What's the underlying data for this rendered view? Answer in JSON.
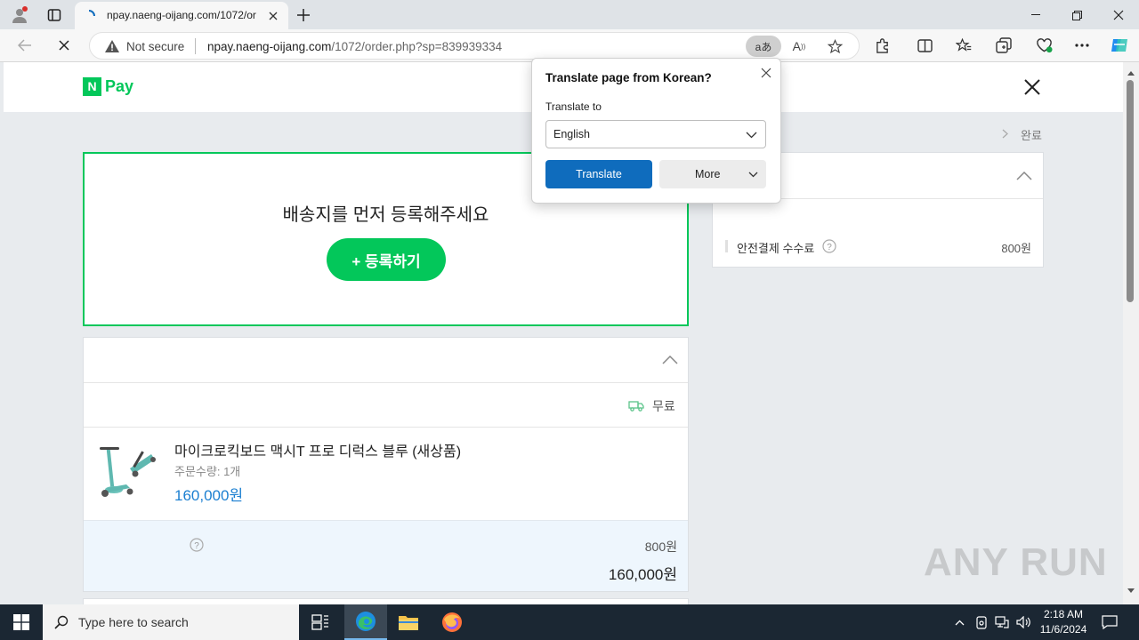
{
  "browser": {
    "tab_title": "npay.naeng-oijang.com/1072/or",
    "security_label": "Not secure",
    "url_domain": "npay.naeng-oijang.com",
    "url_path": "/1072/order.php?sp=839939334",
    "translate_badge": "aあ"
  },
  "translate": {
    "title": "Translate page from Korean?",
    "to_label": "Translate to",
    "language": "English",
    "translate_button": "Translate",
    "more_button": "More"
  },
  "header": {
    "logo_n": "N",
    "logo_pay": "Pay"
  },
  "steps": {
    "last_step": "완료"
  },
  "address": {
    "prompt": "배송지를 먼저 등록해주세요",
    "register_button": "+ 등록하기"
  },
  "shipping": {
    "fee_label": "무료"
  },
  "product": {
    "name": "마이크로킥보드 맥시T 프로 디럭스 블루 (새상품)",
    "quantity": "주문수량: 1개",
    "price": "160,000원"
  },
  "summary_box": {
    "fee": "800원",
    "total": "160,000원"
  },
  "right_panel": {
    "fee_label": "안전결제 수수료",
    "fee_value": "800원"
  },
  "watermark": "ANY RUN",
  "taskbar": {
    "search_placeholder": "Type here to search",
    "time": "2:18 AM",
    "date": "11/6/2024"
  },
  "colors": {
    "npay_green": "#03c75a",
    "link_blue": "#1b7fd1",
    "edge_blue": "#0f6cbd"
  }
}
